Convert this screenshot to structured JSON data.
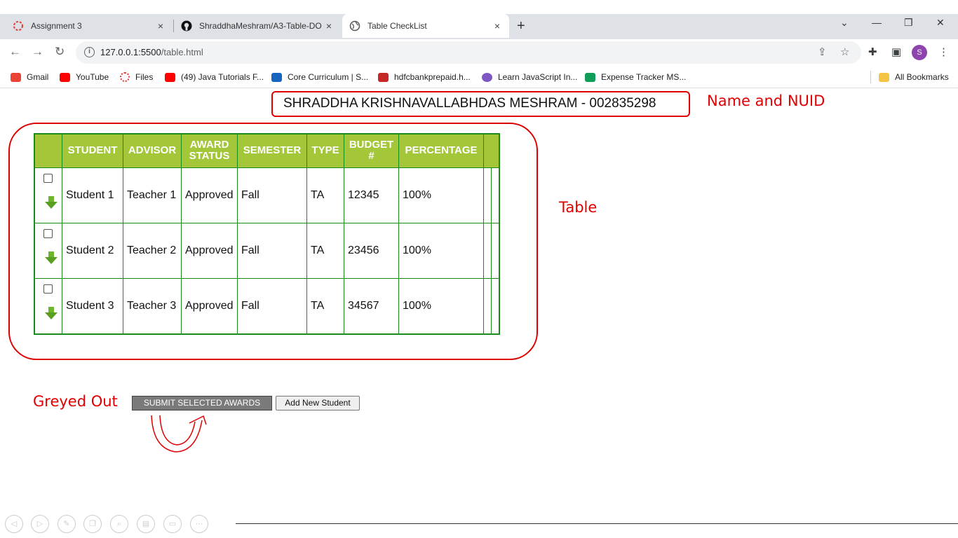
{
  "tabs": [
    {
      "title": "Assignment 3",
      "close": "×"
    },
    {
      "title": "ShraddhaMeshram/A3-Table-DO",
      "close": "×"
    },
    {
      "title": "Table CheckList",
      "close": "×"
    }
  ],
  "new_tab": "+",
  "window": {
    "collapse": "⌄",
    "minimize": "—",
    "restore": "❐",
    "close": "✕"
  },
  "address": {
    "host": "127.0.0.1:5500",
    "path": "/table.html",
    "info": "i"
  },
  "profile_initial": "S",
  "bookmarks": [
    {
      "label": "Gmail",
      "color": "#ea4335"
    },
    {
      "label": "YouTube",
      "color": "#ff0000"
    },
    {
      "label": "Files",
      "color": "#e53935"
    },
    {
      "label": "(49) Java Tutorials F...",
      "color": "#ff0000"
    },
    {
      "label": "Core Curriculum | S...",
      "color": "#1565c0"
    },
    {
      "label": "hdfcbankprepaid.h...",
      "color": "#c62828"
    },
    {
      "label": "Learn JavaScript In...",
      "color": "#7e57c2"
    },
    {
      "label": "Expense Tracker MS...",
      "color": "#0f9d58"
    }
  ],
  "all_bookmarks": "All Bookmarks",
  "name_nuid": "SHRADDHA KRISHNAVALLABHDAS MESHRAM - 002835298",
  "annotations": {
    "name": "Name and NUID",
    "table": "Table",
    "greyed": "Greyed Out"
  },
  "table": {
    "headers": [
      "STUDENT",
      "ADVISOR",
      "AWARD STATUS",
      "SEMESTER",
      "TYPE",
      "BUDGET #",
      "PERCENTAGE"
    ],
    "rows": [
      [
        "Student 1",
        "Teacher 1",
        "Approved",
        "Fall",
        "TA",
        "12345",
        "100%"
      ],
      [
        "Student 2",
        "Teacher 2",
        "Approved",
        "Fall",
        "TA",
        "23456",
        "100%"
      ],
      [
        "Student 3",
        "Teacher 3",
        "Approved",
        "Fall",
        "TA",
        "34567",
        "100%"
      ]
    ]
  },
  "buttons": {
    "submit": "SUBMIT SELECTED AWARDS",
    "add": "Add New Student"
  },
  "colors": {
    "header_bg": "#a4c639",
    "border_green": "#1a8a1a",
    "annotation_red": "#e00000",
    "submit_grey": "#7a7a7a"
  }
}
